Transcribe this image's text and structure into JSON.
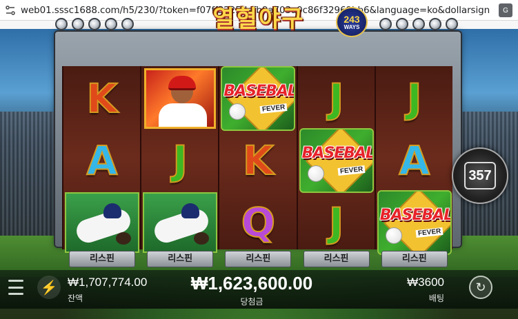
{
  "browser": {
    "url": "web01.sssc1688.com/h5/230/?token=f07ff3225ddfb9a703a0c86f32969bb6&language=ko&dollarsign=Y..."
  },
  "game": {
    "logo_text": "열혈야구",
    "ways_number": "243",
    "ways_label": "WAYS",
    "reels": [
      [
        "K",
        "A",
        "runner"
      ],
      [
        "pitcher",
        "J",
        "runner"
      ],
      [
        "baseball",
        "K",
        "Q"
      ],
      [
        "J",
        "baseball",
        "J"
      ],
      [
        "J",
        "A",
        "baseball"
      ]
    ],
    "baseball_title": "BASEBALL",
    "baseball_sub": "FEVER",
    "respin_label": "리스핀",
    "side_counter": "357"
  },
  "bottom": {
    "balance_value": "₩1,707,774.00",
    "balance_label": "잔액",
    "win_value": "₩1,623,600.00",
    "win_label": "당첨금",
    "bet_value": "₩3600",
    "bet_label": "배팅"
  },
  "colors": {
    "win_text": "#ffffff",
    "logo": "#ffd84a"
  }
}
